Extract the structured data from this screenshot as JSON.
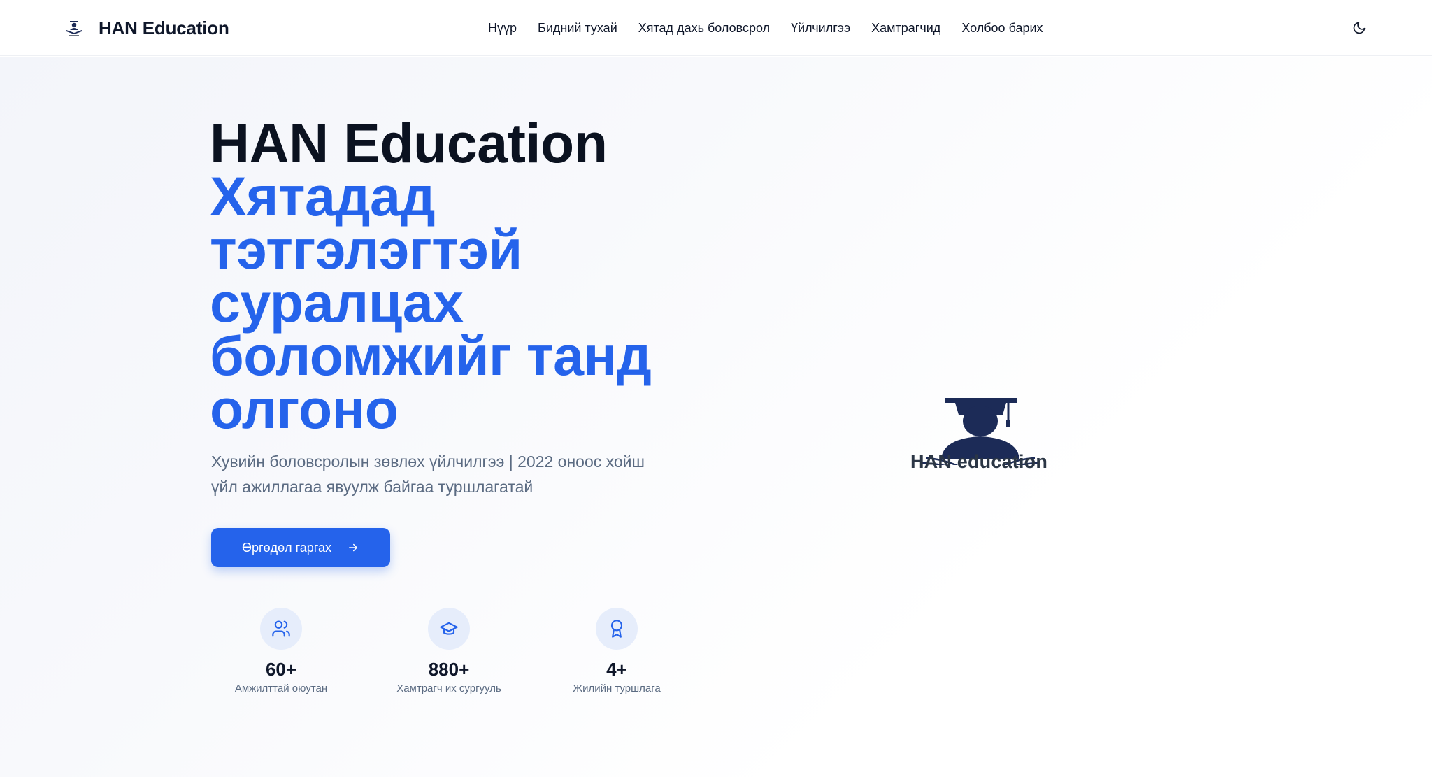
{
  "header": {
    "brand_name": "HAN Education",
    "nav": [
      {
        "label": "Нүүр"
      },
      {
        "label": "Бидний тухай"
      },
      {
        "label": "Хятад дахь боловсрол"
      },
      {
        "label": "Үйлчилгээ"
      },
      {
        "label": "Хамтрагчид"
      },
      {
        "label": "Холбоо барих"
      }
    ],
    "theme_icon": "moon-icon"
  },
  "hero": {
    "title_brand": "HAN Education",
    "title_lines": [
      "Хятадад",
      "тэтгэлэгтэй",
      "суралцах",
      "боломжийг танд",
      "олгоно"
    ],
    "subtitle_line1": "Хувийн боловсролын зөвлөх үйлчилгээ | 2022 оноос хойш",
    "subtitle_line2": "үйл ажиллагаа явуулж байгаа туршлагатай",
    "cta_label": "Өргөдөл гаргах",
    "cta_icon": "arrow-right-icon",
    "logo_text": "HAN education"
  },
  "stats": [
    {
      "icon": "users-icon",
      "value": "60+",
      "label": "Амжилттай оюутан"
    },
    {
      "icon": "graduation-cap-icon",
      "value": "880+",
      "label": "Хамтрагч их сургууль"
    },
    {
      "icon": "award-icon",
      "value": "4+",
      "label": "Жилийн туршлага"
    }
  ],
  "colors": {
    "accent": "#2563eb",
    "text": "#0f172a",
    "muted": "#5b6b82",
    "logo_navy": "#1c2b57",
    "stat_icon_bg": "#e6edfb"
  }
}
